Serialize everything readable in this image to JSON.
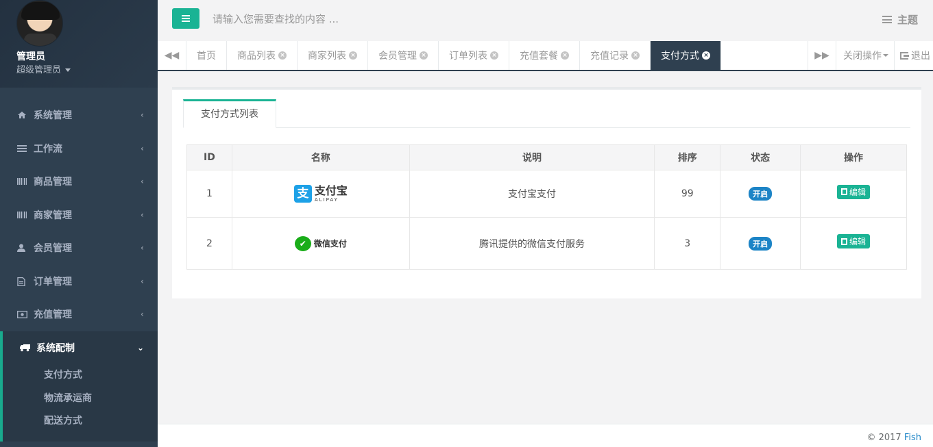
{
  "profile": {
    "name": "管理员",
    "role": "超级管理员"
  },
  "sidebar": {
    "items": [
      {
        "label": "系统管理",
        "icon": "home-icon"
      },
      {
        "label": "工作流",
        "icon": "list-icon"
      },
      {
        "label": "商品管理",
        "icon": "barcode-icon"
      },
      {
        "label": "商家管理",
        "icon": "barcode-icon"
      },
      {
        "label": "会员管理",
        "icon": "user-icon"
      },
      {
        "label": "订单管理",
        "icon": "file-icon"
      },
      {
        "label": "充值管理",
        "icon": "money-icon"
      },
      {
        "label": "系统配制",
        "icon": "truck-icon"
      }
    ],
    "submenu": [
      "支付方式",
      "物流承运商",
      "配送方式"
    ]
  },
  "topbar": {
    "search_placeholder": "请输入您需要查找的内容 ...",
    "theme_label": "主题"
  },
  "tabs": [
    {
      "label": "首页",
      "closable": false
    },
    {
      "label": "商品列表",
      "closable": true
    },
    {
      "label": "商家列表",
      "closable": true
    },
    {
      "label": "会员管理",
      "closable": true
    },
    {
      "label": "订单列表",
      "closable": true
    },
    {
      "label": "充值套餐",
      "closable": true
    },
    {
      "label": "充值记录",
      "closable": true
    },
    {
      "label": "支付方式",
      "closable": true,
      "active": true
    }
  ],
  "tabs_right": {
    "close_ops": "关闭操作",
    "logout": "退出"
  },
  "panel": {
    "tab_label": "支付方式列表"
  },
  "table": {
    "headers": [
      "ID",
      "名称",
      "说明",
      "排序",
      "状态",
      "操作"
    ],
    "rows": [
      {
        "id": "1",
        "logo_cn": "支付宝",
        "logo_en": "ALIPAY",
        "desc": "支付宝支付",
        "sort": "99",
        "status": "开启",
        "action": "编辑"
      },
      {
        "id": "2",
        "logo_cn": "微信支付",
        "logo_en": "",
        "desc": "腾讯提供的微信支付服务",
        "sort": "3",
        "status": "开启",
        "action": "编辑"
      }
    ]
  },
  "footer": {
    "copyright": "© 2017",
    "brand": "Fish"
  },
  "colors": {
    "accent": "#1ab394",
    "sidebar": "#2f4050",
    "badge": "#1c84c6"
  }
}
